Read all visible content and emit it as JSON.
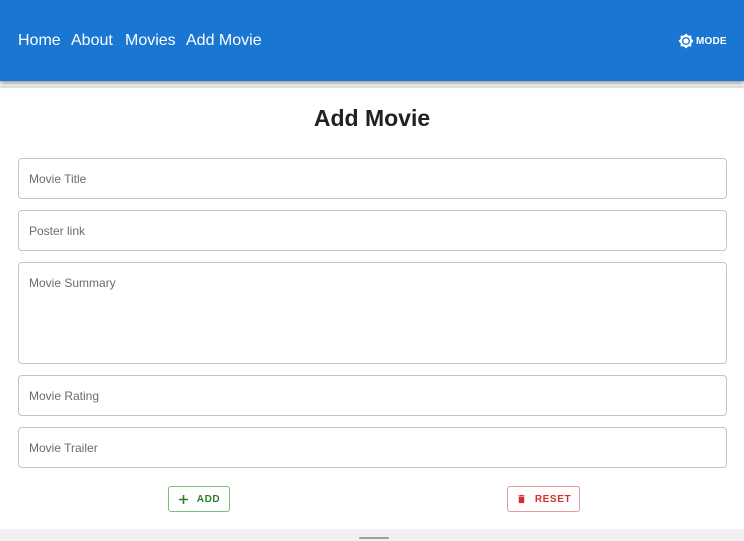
{
  "nav": {
    "links": [
      "Home",
      "About",
      "Movies",
      "Add Movie"
    ],
    "mode_label": "MODE"
  },
  "page": {
    "title": "Add Movie"
  },
  "form": {
    "title_placeholder": "Movie Title",
    "poster_placeholder": "Poster link",
    "summary_placeholder": "Movie Summary",
    "rating_placeholder": "Movie Rating",
    "trailer_placeholder": "Movie Trailer"
  },
  "actions": {
    "add_label": "ADD",
    "reset_label": "RESET"
  },
  "colors": {
    "appbar": "#1976d2",
    "add": "#2e7d32",
    "reset": "#d32f2f"
  },
  "icons": {
    "mode": "brightness-settings-icon",
    "add": "plus-icon",
    "reset": "trash-icon"
  }
}
